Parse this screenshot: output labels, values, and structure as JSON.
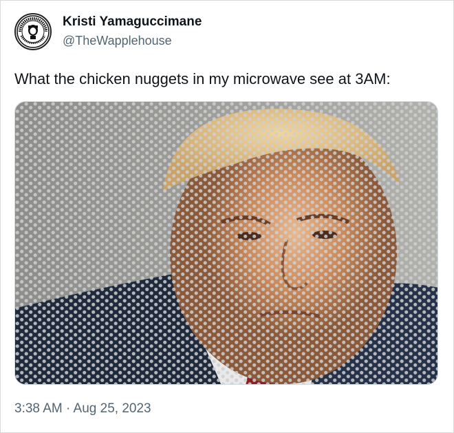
{
  "tweet": {
    "author": {
      "display_name": "Kristi Yamaguccimane",
      "handle": "@TheWapplehouse",
      "avatar_icon": "waffle-house-seal-avatar"
    },
    "text": "What the chicken nuggets in my microwave see at 3AM:",
    "media": {
      "icon": "photo-behind-microwave-mesh",
      "mesh_color": "#cfcfcf",
      "background_color": "#9a9a98"
    },
    "timestamp": "3:38 AM · Aug 25, 2023"
  }
}
